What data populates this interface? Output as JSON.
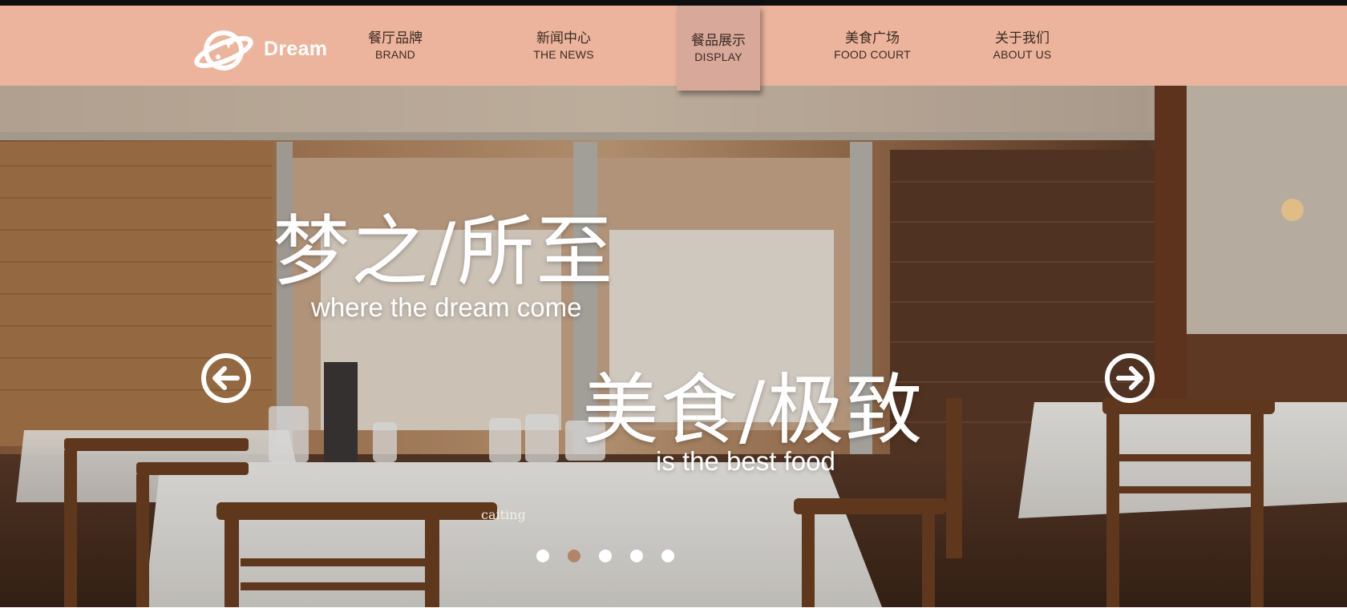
{
  "brand": {
    "name": "Dream",
    "logo_icon": "planet-icon"
  },
  "nav": [
    {
      "zh": "餐厅品牌",
      "en": "BRAND"
    },
    {
      "zh": "新闻中心",
      "en": "THE NEWS"
    },
    {
      "zh": "餐品展示",
      "en": "DISPLAY",
      "active": true
    },
    {
      "zh": "美食广场",
      "en": "FOOD COURT"
    },
    {
      "zh": "关于我们",
      "en": "ABOUT US"
    }
  ],
  "hero": {
    "headline1": "梦之/所至",
    "subline1": "where the dream come",
    "headline2": "美食/极致",
    "subline2": "is the best food",
    "caption": "caiting",
    "prev_icon": "arrow-left-circle-icon",
    "next_icon": "arrow-right-circle-icon",
    "slides_count": 5,
    "active_slide": 2
  },
  "colors": {
    "nav_bg": "#ecb49c",
    "nav_active_bg": "#d8a89a",
    "dot_active": "#b28468",
    "text_white": "#ffffff"
  }
}
